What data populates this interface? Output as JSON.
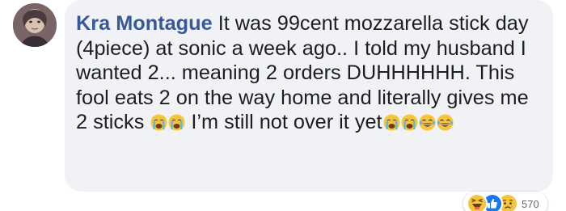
{
  "comment": {
    "author": "Kra Montague",
    "line1_text": "It was 99cent mozzarella stick day (4piece) at sonic a week ago.. I told my husband I wanted 2... meaning 2 orders DUHHHHHH. This fool eats 2 on the way home and literally gives me 2 sticks",
    "inline_emojis_1": [
      "crying-face-icon",
      "crying-face-icon"
    ],
    "line2_text": "I’m still not over it yet",
    "inline_emojis_2": [
      "crying-face-icon",
      "crying-face-icon",
      "laughing-tears-icon",
      "laughing-tears-icon"
    ]
  },
  "reactions": {
    "icons": [
      "haha-reaction-icon",
      "like-reaction-icon",
      "sad-reaction-icon"
    ],
    "count": "570"
  },
  "colors": {
    "bubble": "#f0f2f5",
    "author": "#385898",
    "text": "#1c1e21",
    "like": "#1877f2",
    "emoji_yellow": "#f7c53b"
  }
}
